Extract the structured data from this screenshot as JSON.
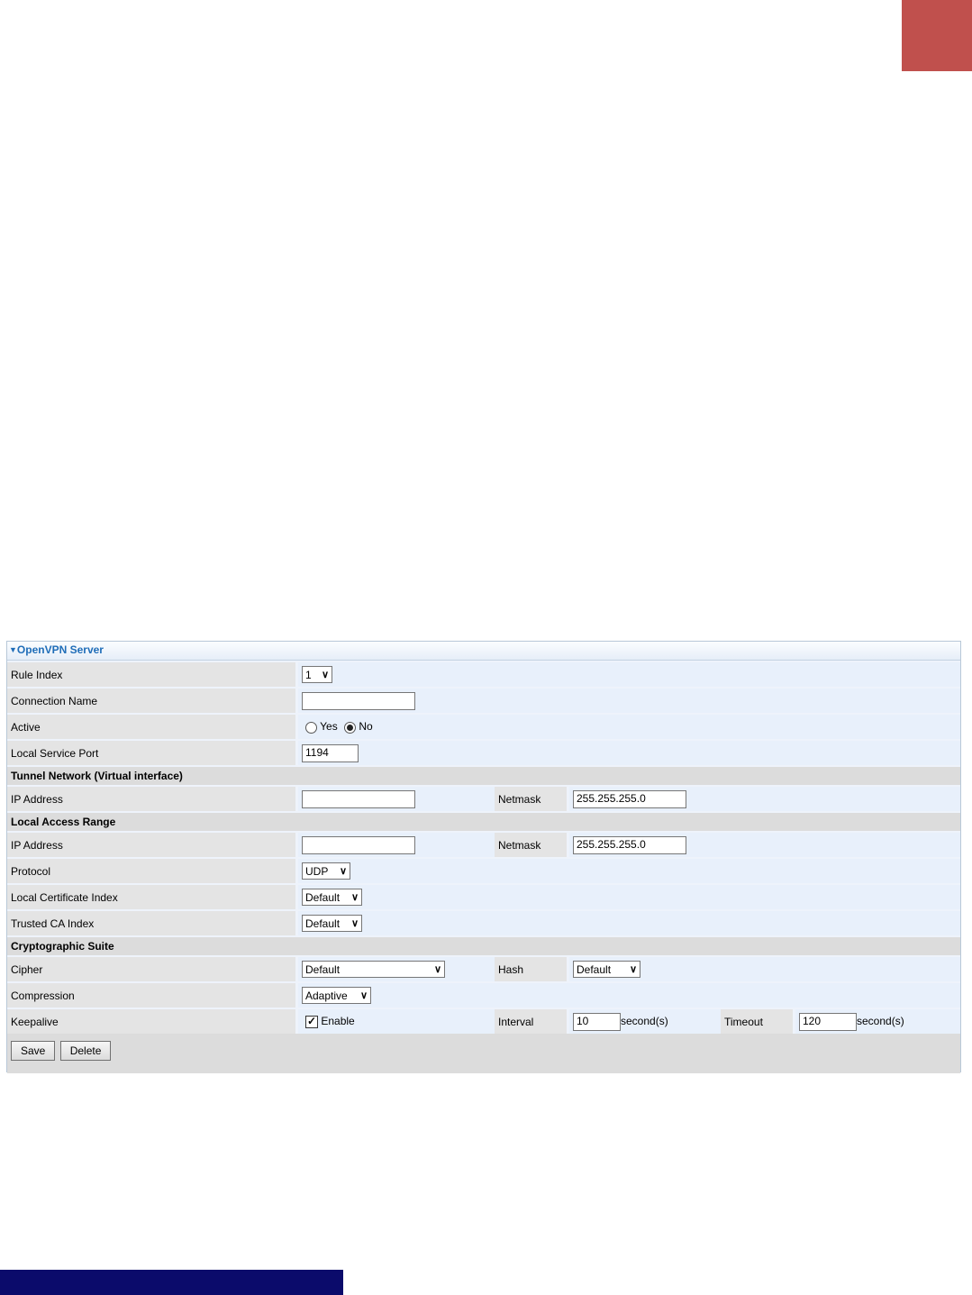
{
  "panel": {
    "title": "OpenVPN Server"
  },
  "fields": {
    "rule_index": {
      "label": "Rule Index",
      "value": "1"
    },
    "connection_name": {
      "label": "Connection Name",
      "value": ""
    },
    "active": {
      "label": "Active",
      "yes": "Yes",
      "no": "No",
      "selected": "No"
    },
    "local_service_port": {
      "label": "Local Service Port",
      "value": "1194"
    }
  },
  "tunnel": {
    "section": "Tunnel Network (Virtual interface)",
    "ip_label": "IP Address",
    "ip_value": "",
    "netmask_label": "Netmask",
    "netmask_value": "255.255.255.0"
  },
  "local_access": {
    "section": "Local Access Range",
    "ip_label": "IP Address",
    "ip_value": "",
    "netmask_label": "Netmask",
    "netmask_value": "255.255.255.0"
  },
  "protocol": {
    "label": "Protocol",
    "value": "UDP"
  },
  "local_cert": {
    "label": "Local Certificate Index",
    "value": "Default"
  },
  "trusted_ca": {
    "label": "Trusted CA Index",
    "value": "Default"
  },
  "crypto": {
    "section": "Cryptographic Suite",
    "cipher_label": "Cipher",
    "cipher_value": "Default",
    "hash_label": "Hash",
    "hash_value": "Default"
  },
  "compression": {
    "label": "Compression",
    "value": "Adaptive"
  },
  "keepalive": {
    "label": "Keepalive",
    "enable_label": "Enable",
    "enabled": true,
    "interval_label": "Interval",
    "interval_value": "10",
    "timeout_label": "Timeout",
    "timeout_value": "120",
    "unit": "second(s)"
  },
  "buttons": {
    "save": "Save",
    "delete": "Delete"
  },
  "colors": {
    "accent_tab": "#c0504d",
    "footer_bar": "#0b0b6b",
    "header_text": "#1f6db8"
  }
}
